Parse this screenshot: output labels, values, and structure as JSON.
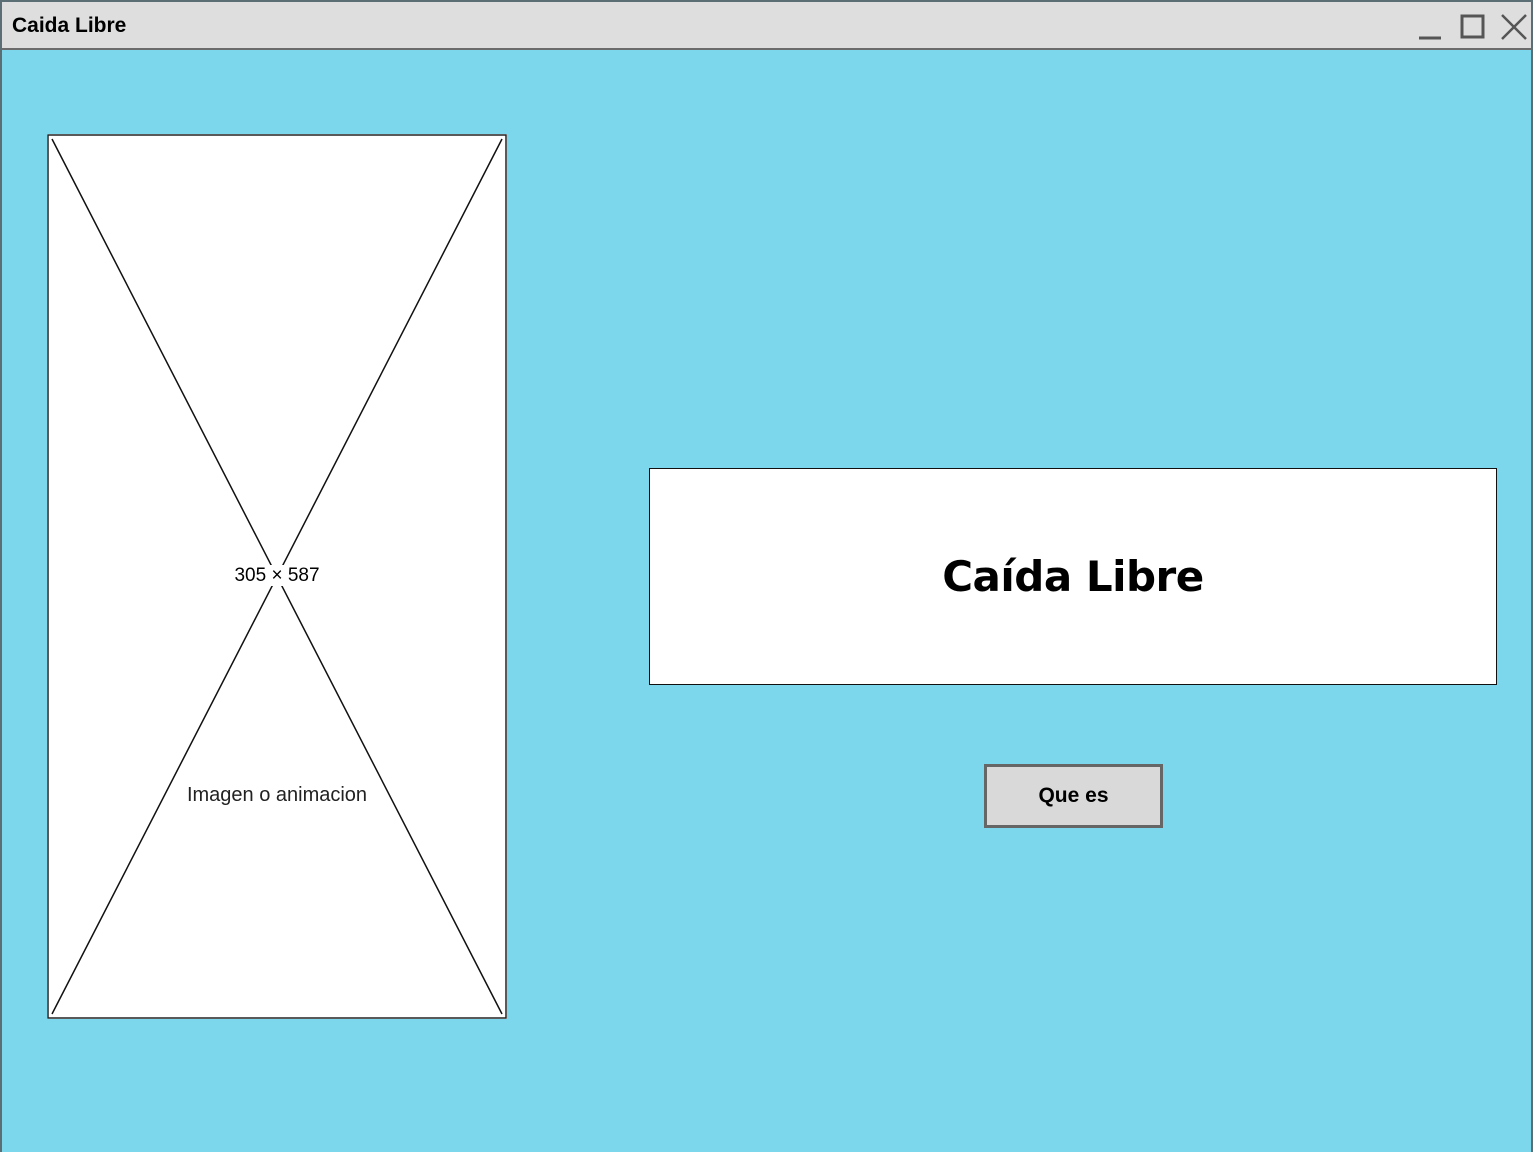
{
  "window": {
    "title": "Caida Libre",
    "background_color": "#7dd7ec",
    "controls": [
      "minimize-icon",
      "maximize-icon",
      "close-icon"
    ]
  },
  "image_placeholder": {
    "dimensions_label": "305 × 587",
    "caption": "Imagen o animacion"
  },
  "heading": {
    "text": "Caída Libre"
  },
  "que_es_button": {
    "label": "Que es"
  }
}
